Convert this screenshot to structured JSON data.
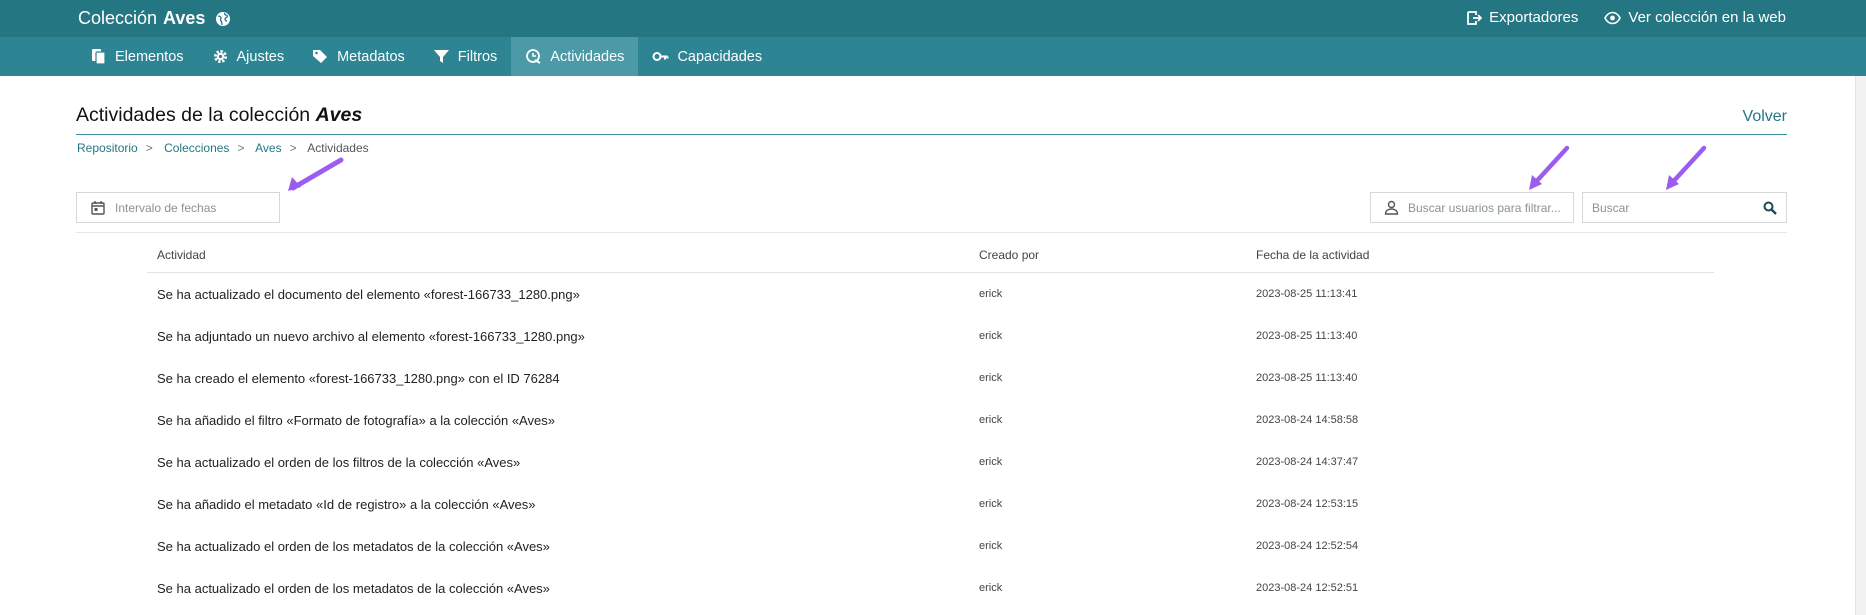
{
  "header": {
    "title_prefix": "Colección",
    "title_bold": "Aves",
    "exporters_label": "Exportadores",
    "view_label": "Ver colección en la web"
  },
  "tabs": [
    {
      "label": "Elementos",
      "icon": "elements-icon"
    },
    {
      "label": "Ajustes",
      "icon": "gear-icon"
    },
    {
      "label": "Metadatos",
      "icon": "tags-icon"
    },
    {
      "label": "Filtros",
      "icon": "filter-icon"
    },
    {
      "label": "Actividades",
      "icon": "activity-icon",
      "active": true
    },
    {
      "label": "Capacidades",
      "icon": "key-icon"
    }
  ],
  "page": {
    "title_prefix": "Actividades de la colección",
    "title_italic": "Aves",
    "back_label": "Volver"
  },
  "breadcrumb": [
    "Repositorio",
    "Colecciones",
    "Aves",
    "Actividades"
  ],
  "filters": {
    "date_placeholder": "Intervalo de fechas",
    "user_placeholder": "Buscar usuarios para filtrar...",
    "search_placeholder": "Buscar"
  },
  "table": {
    "headers": [
      "Actividad",
      "Creado por",
      "Fecha de la actividad"
    ],
    "rows": [
      {
        "activity": "Se ha actualizado el documento del elemento «forest-166733_1280.png»",
        "user": "erick",
        "date": "2023-08-25 11:13:41"
      },
      {
        "activity": "Se ha adjuntado un nuevo archivo al elemento «forest-166733_1280.png»",
        "user": "erick",
        "date": "2023-08-25 11:13:40"
      },
      {
        "activity": "Se ha creado el elemento «forest-166733_1280.png» con el ID 76284",
        "user": "erick",
        "date": "2023-08-25 11:13:40"
      },
      {
        "activity": "Se ha añadido el filtro «Formato de fotografía» a la colección «Aves»",
        "user": "erick",
        "date": "2023-08-24 14:58:58"
      },
      {
        "activity": "Se ha actualizado el orden de los filtros de la colección «Aves»",
        "user": "erick",
        "date": "2023-08-24 14:37:47"
      },
      {
        "activity": "Se ha añadido el metadato «Id de registro» a la colección «Aves»",
        "user": "erick",
        "date": "2023-08-24 12:53:15"
      },
      {
        "activity": "Se ha actualizado el orden de los metadatos de la colección «Aves»",
        "user": "erick",
        "date": "2023-08-24 12:52:54"
      },
      {
        "activity": "Se ha actualizado el orden de los metadatos de la colección «Aves»",
        "user": "erick",
        "date": "2023-08-24 12:52:51"
      }
    ]
  },
  "colors": {
    "header": "#257683",
    "tabs": "#2d8594",
    "active_tab": "#4c9aa7",
    "annotation_arrow": "#9b5cf0"
  }
}
